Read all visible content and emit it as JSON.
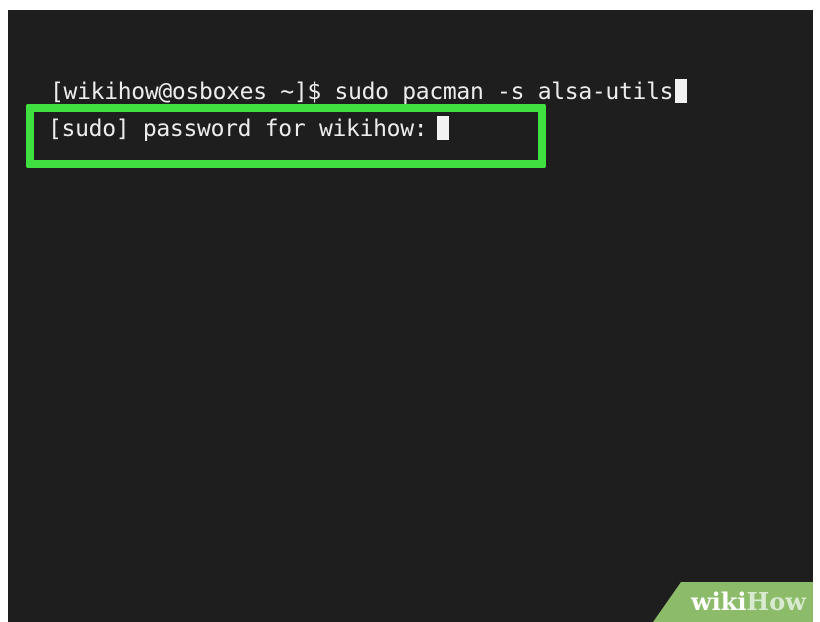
{
  "terminal": {
    "prompt_line": "[wikihow@osboxes ~]$ sudo pacman -s alsa-utils",
    "password_prompt": "[sudo] password for wikihow:"
  },
  "watermark": {
    "wiki": "wiki",
    "how": "How"
  },
  "colors": {
    "terminal_bg": "#1e1e1e",
    "text": "#ececec",
    "highlight_border": "#3fe03f",
    "watermark_bg": "#8cbc6a"
  }
}
